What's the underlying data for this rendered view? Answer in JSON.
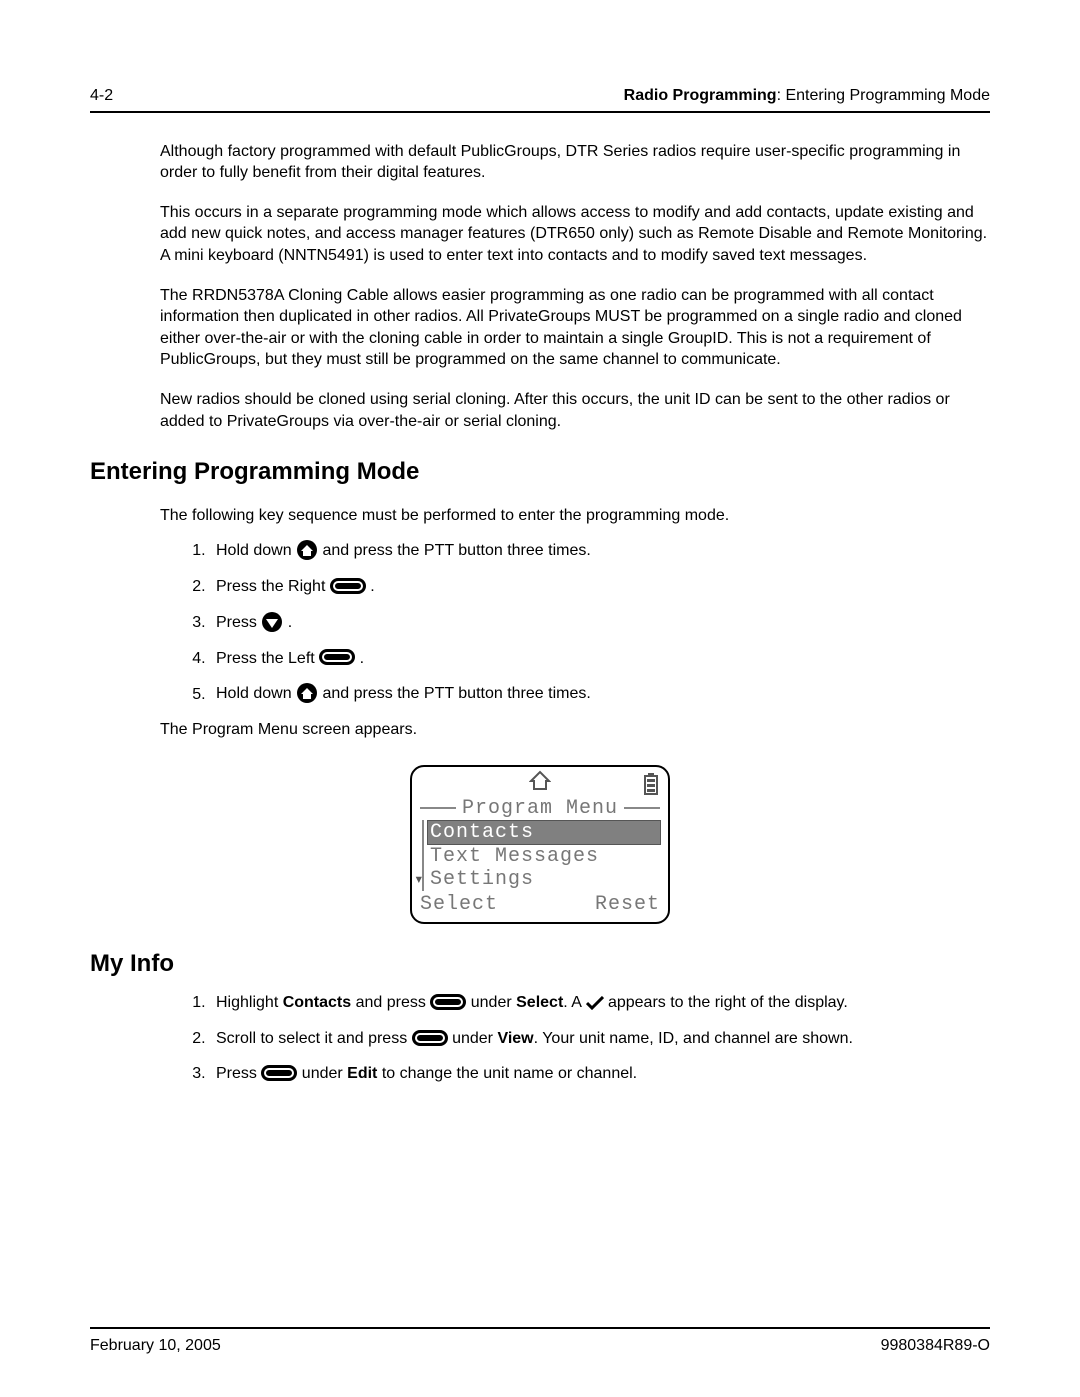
{
  "header": {
    "page_num": "4-2",
    "chapter": "Radio Programming",
    "section": "Entering Programming Mode"
  },
  "paragraphs": {
    "p1": "Although factory programmed with default PublicGroups, DTR Series radios require user-specific programming in order to fully benefit from their digital features.",
    "p2": "This occurs in a separate programming mode which allows access to modify and add contacts, update existing and add new quick notes, and access manager features (DTR650 only) such as Remote Disable and Remote Monitoring. A mini keyboard (NNTN5491) is used to enter text into contacts and to modify saved text messages.",
    "p3": "The RRDN5378A Cloning Cable allows easier programming as one radio can be programmed with all contact information then duplicated in other radios. All PrivateGroups MUST be programmed on a single radio and cloned either over-the-air or with the cloning cable in order to maintain a single GroupID. This is not a requirement of PublicGroups, but they must still be programmed on the same channel to communicate.",
    "p4": "New radios should be cloned using serial cloning. After this occurs, the unit ID can be sent to the other radios or added to PrivateGroups via over-the-air or serial cloning."
  },
  "h_enter": "Entering Programming Mode",
  "enter_intro": "The following key sequence must be performed to enter the programming mode.",
  "steps_enter": {
    "s1a": "Hold down ",
    "s1b": " and press the PTT button three times.",
    "s2a": "Press the Right ",
    "s2b": " .",
    "s3a": "Press ",
    "s3b": " .",
    "s4a": "Press the Left ",
    "s4b": " .",
    "s5a": "Hold down ",
    "s5b": " and press the PTT button three times."
  },
  "after_enter": "The Program Menu screen appears.",
  "lcd": {
    "title": "Program Menu",
    "items": [
      "Contacts",
      "Text Messages",
      "Settings"
    ],
    "selected_index": 0,
    "soft_left": "Select",
    "soft_right": "Reset"
  },
  "h_myinfo": "My Info",
  "my1": {
    "a": "Highlight ",
    "b": "Contacts",
    "c": " and press ",
    "d": " under ",
    "e": "Select",
    "f": ". A ",
    "g": " appears to the right of the display."
  },
  "my2": {
    "a": "Scroll to select it and press ",
    "b": " under ",
    "c": "View",
    "d": ". Your unit name, ID, and channel are shown."
  },
  "my3": {
    "a": "Press ",
    "b": " under ",
    "c": "Edit",
    "d": " to change the unit name or channel."
  },
  "footer": {
    "date": "February 10, 2005",
    "docnum": "9980384R89-O"
  },
  "icons": {
    "home": "home-icon",
    "soft": "softkey-icon",
    "down": "down-arrow-icon",
    "check": "check-icon",
    "battery": "battery-icon"
  }
}
